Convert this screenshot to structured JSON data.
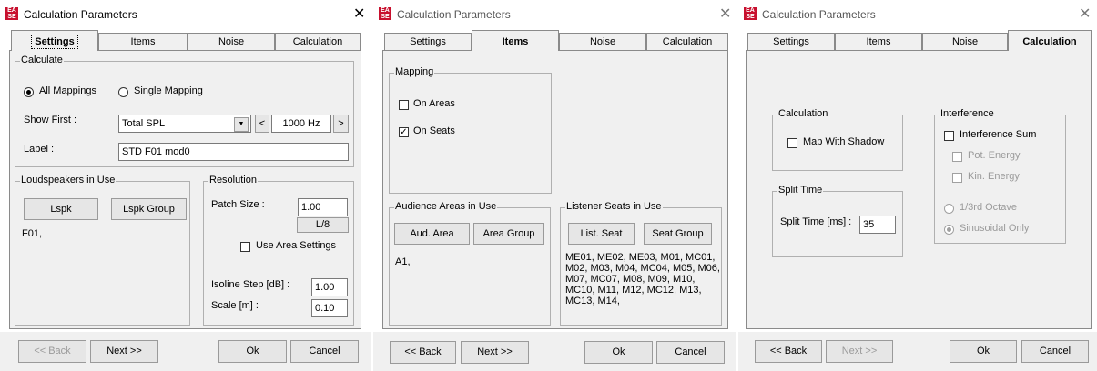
{
  "dialogs": [
    {
      "title": "Calculation Parameters",
      "tabs": [
        "Settings",
        "Items",
        "Noise",
        "Calculation"
      ],
      "active_tab": "Settings",
      "calculate_group": "Calculate",
      "radio_all": "All Mappings",
      "radio_single": "Single Mapping",
      "show_first_label": "Show First :",
      "show_first_value": "Total SPL",
      "frequency_value": "1000 Hz",
      "label_label": "Label :",
      "label_value": "STD F01 mod0",
      "loudspeakers_group": "Loudspeakers in Use",
      "lspk_button": "Lspk",
      "lspk_group_button": "Lspk Group",
      "loudspeakers_list": "F01,",
      "resolution_group": "Resolution",
      "patch_size_label": "Patch Size :",
      "patch_size_value": "1.00",
      "l8_button": "L/8",
      "use_area_settings": "Use Area Settings",
      "isoline_label": "Isoline Step [dB] :",
      "isoline_value": "1.00",
      "scale_label": "Scale [m] :",
      "scale_value": "0.10",
      "back_button": "<< Back",
      "next_button": "Next >>",
      "ok_button": "Ok",
      "cancel_button": "Cancel"
    },
    {
      "title": "Calculation Parameters",
      "tabs": [
        "Settings",
        "Items",
        "Noise",
        "Calculation"
      ],
      "active_tab": "Items",
      "mapping_group": "Mapping",
      "on_areas": "On Areas",
      "on_seats": "On Seats",
      "audience_group": "Audience Areas in Use",
      "aud_area_button": "Aud. Area",
      "area_group_button": "Area Group",
      "audience_list": "A1,",
      "listener_group": "Listener Seats in Use",
      "list_seat_button": "List. Seat",
      "seat_group_button": "Seat Group",
      "seats_list": [
        "ME01, ME02, ME03, M01, MC01,",
        "M02, M03, M04, MC04, M05, M06,",
        "M07, MC07, M08, M09, M10,",
        "MC10, M11, M12, MC12, M13,",
        "MC13, M14,"
      ],
      "back_button": "<< Back",
      "next_button": "Next >>",
      "ok_button": "Ok",
      "cancel_button": "Cancel"
    },
    {
      "title": "Calculation Parameters",
      "tabs": [
        "Settings",
        "Items",
        "Noise",
        "Calculation"
      ],
      "active_tab": "Calculation",
      "calculation_group": "Calculation",
      "map_with_shadow": "Map With Shadow",
      "interference_group": "Interference",
      "interference_sum": "Interference Sum",
      "pot_energy": "Pot. Energy",
      "kin_energy": "Kin. Energy",
      "third_octave": "1/3rd Octave",
      "sinusoidal_only": "Sinusoidal Only",
      "split_time_group": "Split Time",
      "split_time_label": "Split Time [ms] :",
      "split_time_value": "35",
      "back_button": "<< Back",
      "next_button": "Next >>",
      "ok_button": "Ok",
      "cancel_button": "Cancel"
    }
  ],
  "icons": {
    "app": "ease-logo-icon",
    "close": "close-icon",
    "dropdown": "chevron-down-icon",
    "prev": "chevron-left-icon",
    "next": "chevron-right-icon"
  },
  "colors": {
    "app_icon": "#c8102e",
    "panel": "#f0f0f0",
    "disabled_text": "#9a9a9a"
  }
}
